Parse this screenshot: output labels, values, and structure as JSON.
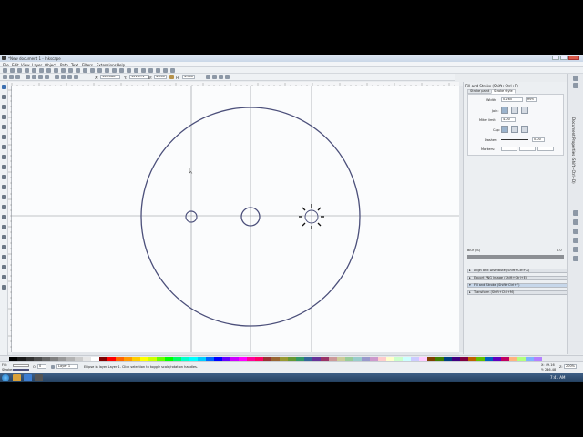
{
  "window": {
    "title": "*New document 1 - Inkscape"
  },
  "menu": [
    "File",
    "Edit",
    "View",
    "Layer",
    "Object",
    "Path",
    "Text",
    "Filters",
    "Extensions",
    "Help"
  ],
  "tool_controls": {
    "x_label": "X:",
    "x_value": "128.088",
    "y_label": "Y:",
    "y_value": "121.171",
    "w_label": "W:",
    "w_value": "4.000",
    "h_label": "H:",
    "h_value": "4.000"
  },
  "dock": {
    "panel_title": "Fill and Stroke (Shift+Ctrl+F)",
    "tabs": [
      "Stroke paint",
      "Stroke style"
    ],
    "active_tab": "Stroke style",
    "width_label": "Width:",
    "width_value": "0.265",
    "width_unit": "mm",
    "join_label": "Join:",
    "miter_label": "Miter limit:",
    "miter_value": "4.00",
    "cap_label": "Cap:",
    "dashes_label": "Dashes:",
    "dashes_value": "0.00",
    "markers_label": "Markers:",
    "blur_label": "Blur (%)",
    "blur_value": "0.0",
    "docked_dialogs": [
      "Align and Distribute (Shift+Ctrl+A)",
      "Export PNG Image (Shift+Ctrl+E)",
      "Fill and Stroke (Shift+Ctrl+F)",
      "Transform (Shift+Ctrl+M)"
    ]
  },
  "vertical_tabs": [
    "Document Properties (Shift+Ctrl+D)"
  ],
  "status": {
    "fill_label": "Fill:",
    "stroke_label": "Stroke:",
    "opacity_label": "O:",
    "opacity_value": "0",
    "layer_value": "Layer 1",
    "message": "Ellipse in layer Layer 1. Click selection to toggle scale/rotation handles.",
    "coord_x": "X: 49.16",
    "coord_y": "Y: 246.48",
    "zoom_label": "Z:",
    "zoom_value": "200%"
  },
  "taskbar": {
    "clock": "7:41 AM"
  },
  "colors": {
    "circle_stroke": "#4b4f7a",
    "guide": "#8a8e94",
    "selection_cursor": "#111111"
  }
}
